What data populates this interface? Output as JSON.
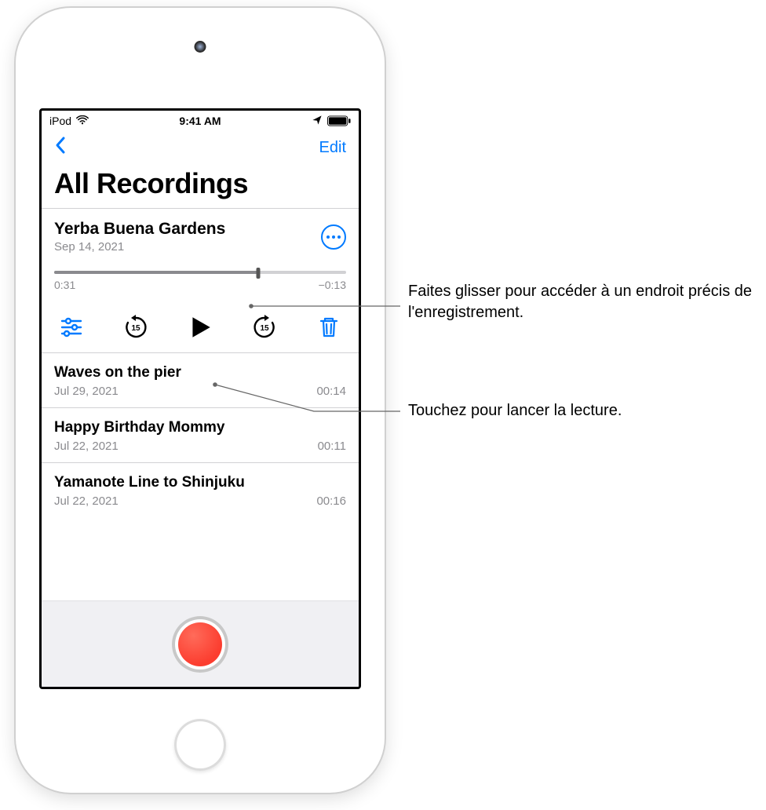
{
  "status_bar": {
    "carrier": "iPod",
    "time": "9:41 AM"
  },
  "nav": {
    "edit_label": "Edit"
  },
  "page": {
    "title": "All Recordings"
  },
  "selected": {
    "title": "Yerba Buena Gardens",
    "date": "Sep 14, 2021",
    "elapsed": "0:31",
    "remaining": "−0:13"
  },
  "recordings": [
    {
      "title": "Waves on the pier",
      "date": "Jul 29, 2021",
      "duration": "00:14"
    },
    {
      "title": "Happy Birthday Mommy",
      "date": "Jul 22, 2021",
      "duration": "00:11"
    },
    {
      "title": "Yamanote Line to Shinjuku",
      "date": "Jul 22, 2021",
      "duration": "00:16"
    }
  ],
  "callouts": {
    "scrub": "Faites glisser pour accéder à un endroit précis de l'enregistrement.",
    "play": "Touchez pour lancer la lecture."
  }
}
